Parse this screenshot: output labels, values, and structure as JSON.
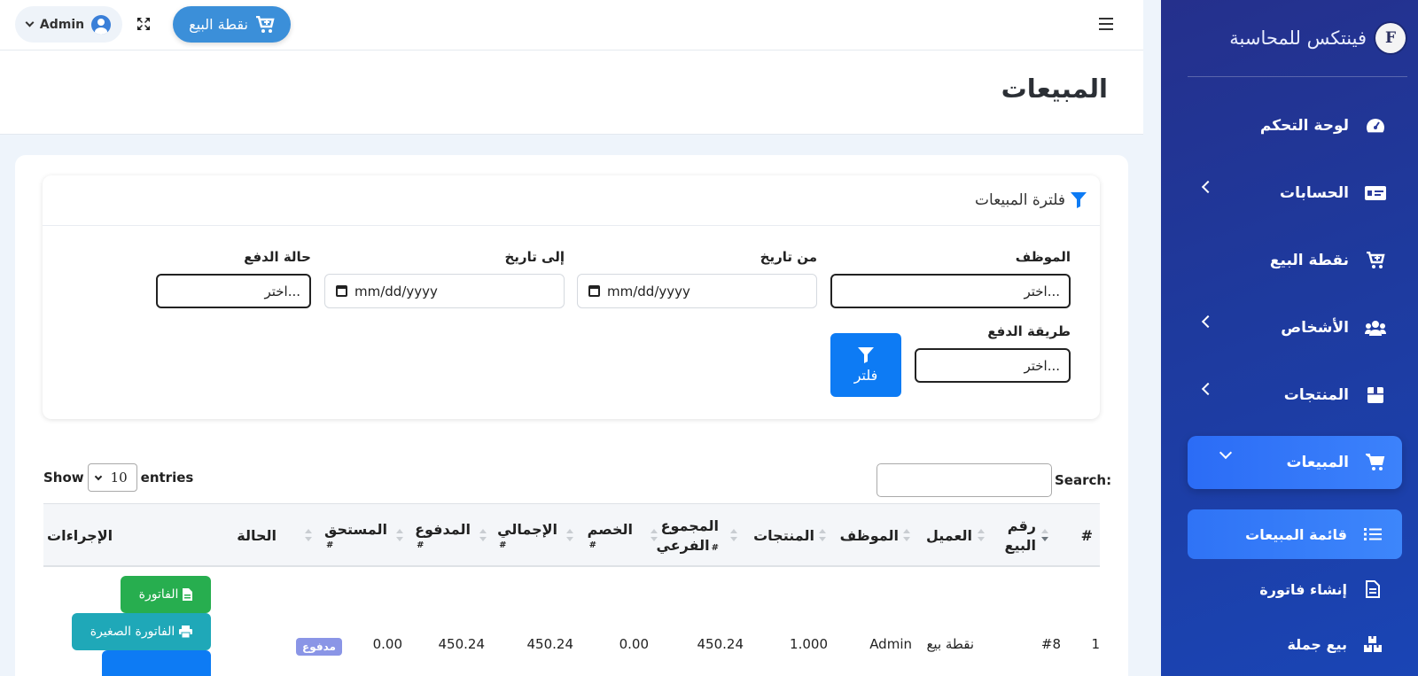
{
  "sidebar": {
    "brand": {
      "logo_text": "F",
      "name": "فينتكس للمحاسبة"
    },
    "items": [
      {
        "label": "لوحة التحكم",
        "icon": "dashboard-icon",
        "has_children": false
      },
      {
        "label": "الحسابات",
        "icon": "money-check-icon",
        "has_children": true
      },
      {
        "label": "نقطة البيع",
        "icon": "cart-plus-icon",
        "has_children": false
      },
      {
        "label": "الأشخاص",
        "icon": "users-icon",
        "has_children": true
      },
      {
        "label": "المنتجات",
        "icon": "box-icon",
        "has_children": true
      },
      {
        "label": "المبيعات",
        "icon": "shopping-cart-icon",
        "has_children": true,
        "active": true
      }
    ],
    "sub_items": [
      {
        "label": "قائمة المبيعات",
        "icon": "list-icon",
        "active": true
      },
      {
        "label": "إنشاء فاتورة",
        "icon": "file-invoice-icon"
      },
      {
        "label": "بيع جملة",
        "icon": "boxes-icon"
      }
    ]
  },
  "topbar": {
    "user": "Admin",
    "pos_button": "نقطة البيع"
  },
  "page": {
    "title": "المبيعات"
  },
  "filter": {
    "title": "فلترة المبيعات",
    "employee_label": "الموظف",
    "employee_value": "اختر...",
    "from_date_label": "من تاريخ",
    "from_date_value": "mm/dd/yyyy",
    "to_date_label": "إلى تاريخ",
    "to_date_value": "mm/dd/yyyy",
    "payment_status_label": "حالة الدفع",
    "payment_status_value": "اختر...",
    "payment_method_label": "طريقة الدفع",
    "payment_method_value": "اختر...",
    "filter_button": "فلتر"
  },
  "table_controls": {
    "show_label": "Show",
    "entries_value": "10",
    "entries_label": "entries",
    "search_label": "Search:"
  },
  "table": {
    "columns": {
      "index": "#",
      "sale_no_line1": "رقم",
      "sale_no_line2": "البيع",
      "customer": "العميل",
      "employee": "الموظف",
      "products": "المنتجات",
      "subtotal_line1": "المجموع",
      "subtotal_line2": "الفرعي",
      "discount": "الخصم",
      "total": "الإجمالي",
      "paid": "المدفوع",
      "due": "المستحق",
      "status": "الحالة",
      "actions": "الإجراءات"
    },
    "hash_marker": "#",
    "rows": [
      {
        "index": "1",
        "sale_no": "#8",
        "customer": "نقطة بيع",
        "employee": "Admin",
        "products": "1.000",
        "subtotal": "450.24",
        "discount": "0.00",
        "total": "450.24",
        "paid": "450.24",
        "due": "0.00",
        "status": "مدفوع",
        "actions": {
          "invoice": "الفاتورة",
          "small_invoice": "الفاتورة الصغيرة"
        }
      }
    ]
  },
  "colors": {
    "sidebar_gradient_start": "#25308c",
    "sidebar_gradient_end": "#1a45b5",
    "primary": "#0d7bf4",
    "pos_button": "#3b8fd9",
    "invoice_button": "#27ae4f",
    "small_invoice_button": "#1fa8b8",
    "paid_badge": "#8a95e6"
  }
}
